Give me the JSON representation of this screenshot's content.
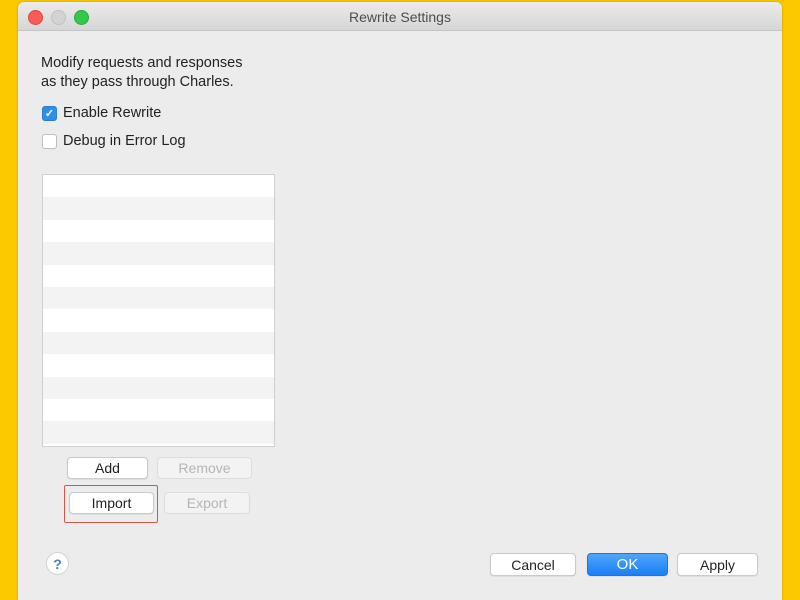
{
  "window": {
    "title": "Rewrite Settings"
  },
  "description": {
    "line1": "Modify requests and responses",
    "line2": "as they pass through Charles."
  },
  "options": [
    {
      "label": "Enable Rewrite",
      "checked": true,
      "check_glyph": "✓"
    },
    {
      "label": "Debug in Error Log",
      "checked": false
    }
  ],
  "rules_list": {
    "rows": [
      "",
      "",
      "",
      "",
      "",
      "",
      "",
      "",
      "",
      "",
      "",
      ""
    ]
  },
  "list_buttons": {
    "add": "Add",
    "remove": "Remove",
    "import": "Import",
    "export": "Export"
  },
  "footer": {
    "help_icon": "?",
    "cancel": "Cancel",
    "ok": "OK",
    "apply": "Apply"
  },
  "colors": {
    "background": "#fcc800",
    "accent": "#1a7ff5",
    "highlight": "#d2564a"
  }
}
